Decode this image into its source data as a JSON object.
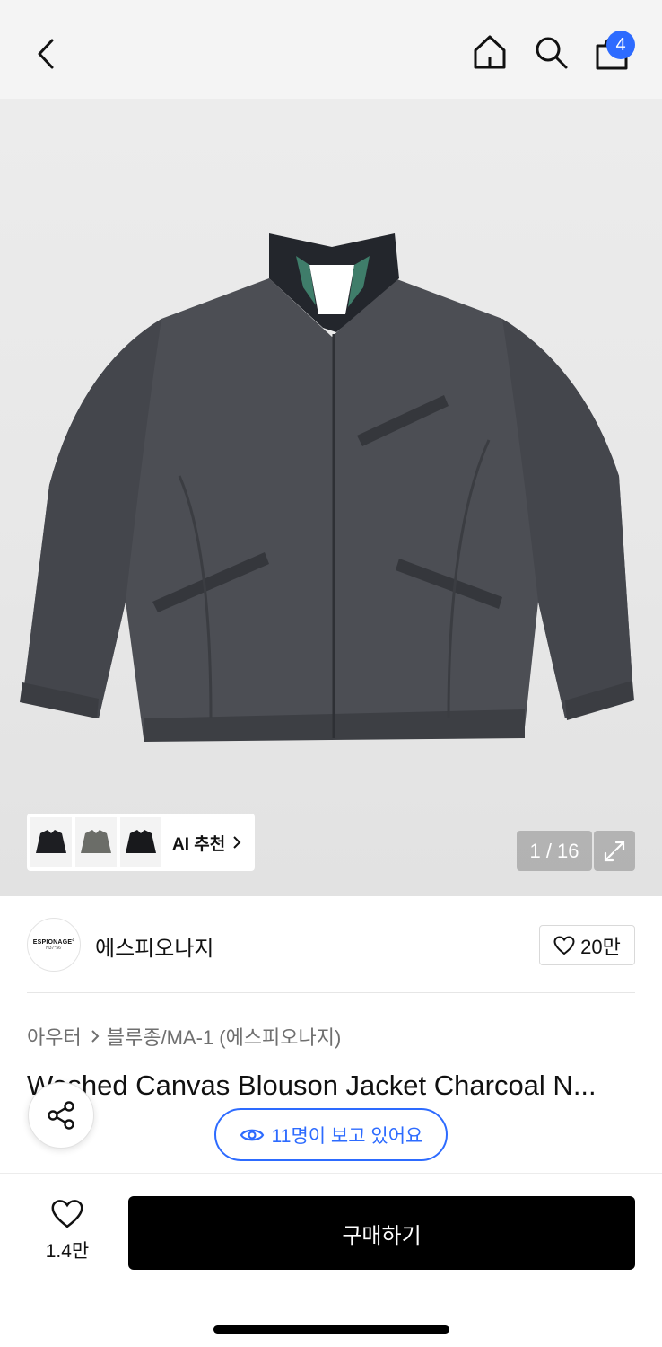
{
  "nav": {
    "back_icon": "chevron-left-icon",
    "home_icon": "home-icon",
    "search_icon": "search-icon",
    "cart_icon": "shopping-bag-icon",
    "cart_badge": "4",
    "badge_color": "#2d6bff"
  },
  "gallery": {
    "ai_label": "AI 추천",
    "counter": "1 / 16",
    "expand_icon": "expand-icon"
  },
  "brand": {
    "logo_line1": "ESPIONAGE°",
    "logo_line2": "N37°56'",
    "name": "에스피오나지",
    "likes": "20만"
  },
  "breadcrumb": {
    "category": "아우터",
    "subcategory": "블루종/MA-1 (에스피오나지)"
  },
  "product": {
    "title": "Washed Canvas Blouson Jacket Charcoal N..."
  },
  "viewers": {
    "text": "11명이 보고 있어요"
  },
  "bottom": {
    "wish_count": "1.4만",
    "buy_label": "구매하기"
  },
  "colors": {
    "accent": "#2d6bff",
    "buy_button": "#000000"
  }
}
